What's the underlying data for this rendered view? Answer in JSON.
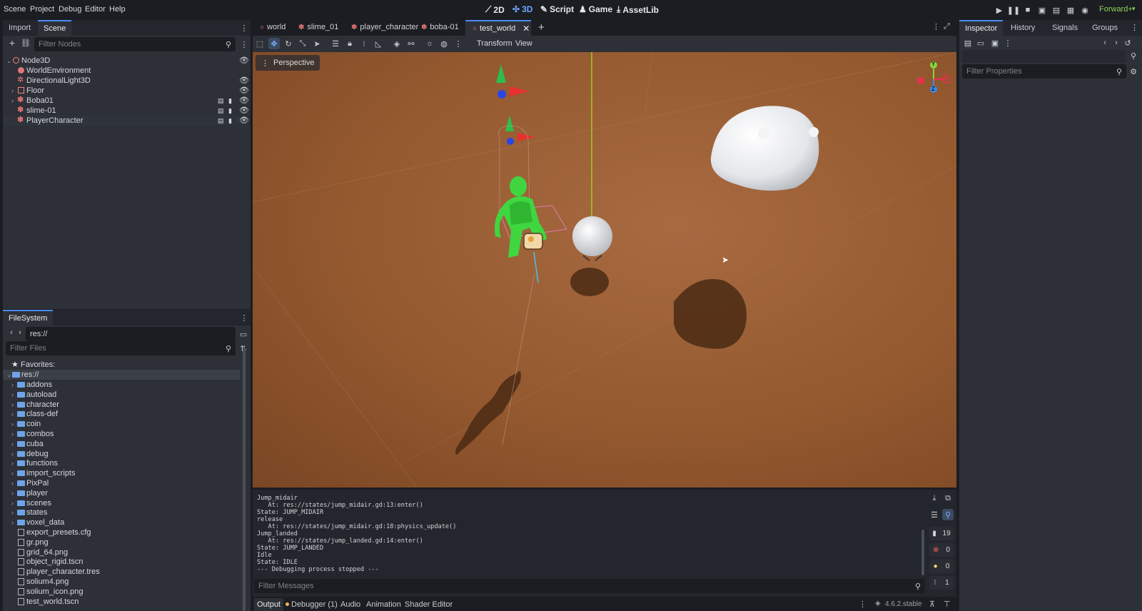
{
  "menu": [
    "Scene",
    "Project",
    "Debug",
    "Editor",
    "Help"
  ],
  "modes": [
    {
      "label": "2D",
      "icon": "2d-icon",
      "active": false
    },
    {
      "label": "3D",
      "icon": "3d-icon",
      "active": true
    },
    {
      "label": "Script",
      "icon": "script-icon",
      "active": false
    },
    {
      "label": "Game",
      "icon": "game-icon",
      "active": false
    },
    {
      "label": "AssetLib",
      "icon": "assetlib-icon",
      "active": false
    }
  ],
  "renderer": "Forward+",
  "left_tabs": [
    "Import",
    "Scene"
  ],
  "scene_filter_placeholder": "Filter Nodes",
  "scene_tree": [
    {
      "label": "Node3D",
      "icon": "node3d-icon",
      "color": "#fc7f7f"
    },
    {
      "label": "WorldEnvironment",
      "icon": "world-environment-icon",
      "color": "#fc7f7f"
    },
    {
      "label": "DirectionalLight3D",
      "icon": "light-icon",
      "color": "#fc7f7f"
    },
    {
      "label": "Floor",
      "icon": "floor-icon",
      "color": "#fc7f7f"
    },
    {
      "label": "Boba01",
      "icon": "character-icon",
      "color": "#fc7f7f"
    },
    {
      "label": "slime-01",
      "icon": "character-icon",
      "color": "#fc7f7f"
    },
    {
      "label": "PlayerCharacter",
      "icon": "character-icon",
      "color": "#fc7f7f"
    }
  ],
  "filesystem": {
    "tab": "FileSystem",
    "path": "res://",
    "filter_placeholder": "Filter Files",
    "favorites": "Favorites:",
    "root": "res://",
    "folders": [
      "addons",
      "autoload",
      "character",
      "class-def",
      "coin",
      "combos",
      "cuba",
      "debug",
      "functions",
      "import_scripts",
      "PixPal",
      "player",
      "scenes",
      "states",
      "voxel_data"
    ],
    "files": [
      "export_presets.cfg",
      "gr.png",
      "grid_64.png",
      "object_rigid.tscn",
      "player_character.tres",
      "solium4.png",
      "solium_icon.png",
      "test_world.tscn"
    ]
  },
  "scene_tabs": [
    {
      "label": "world",
      "active": false
    },
    {
      "label": "slime_01",
      "active": false
    },
    {
      "label": "player_character",
      "active": false
    },
    {
      "label": "boba-01",
      "active": false
    },
    {
      "label": "test_world",
      "active": true
    }
  ],
  "viewport_menu": {
    "transform": "Transform",
    "view": "View",
    "perspective": "Perspective"
  },
  "gizmo": {
    "y": "Y",
    "z": "Z"
  },
  "right_tabs": [
    "Inspector",
    "History",
    "Signals",
    "Groups"
  ],
  "inspector_filter_placeholder": "Filter Properties",
  "output": {
    "lines": [
      "Jump_midair",
      "   At: res://states/jump_midair.gd:13:enter()",
      "State: JUMP_MIDAIR",
      "release",
      "   At: res://states/jump_midair.gd:18:physics_update()",
      "Jump_landed",
      "   At: res://states/jump_landed.gd:14:enter()",
      "State: JUMP_LANDED",
      "Idle",
      "State: IDLE",
      "--- Debugging process stopped ---"
    ],
    "filter_placeholder": "Filter Messages",
    "counts": {
      "messages": "19",
      "errors": "0",
      "warnings": "0",
      "info": "1"
    }
  },
  "bottom_tabs": [
    "Output",
    "Debugger (1)",
    "Audio",
    "Animation",
    "Shader Editor"
  ],
  "version": "4.6.2.stable"
}
